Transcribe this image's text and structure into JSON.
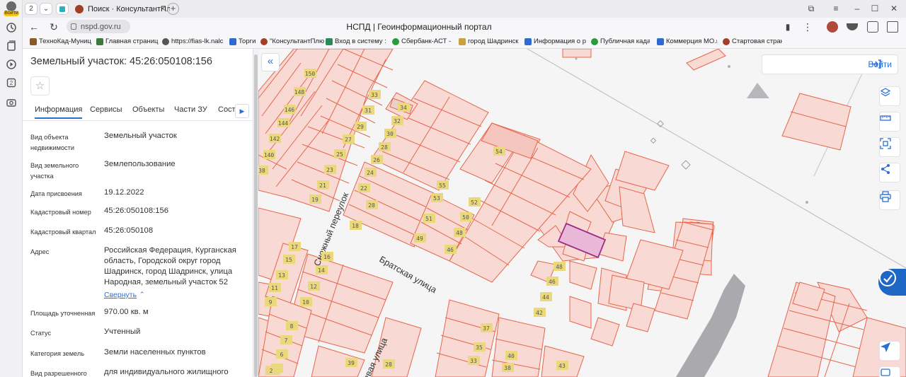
{
  "browser": {
    "tab_count": "2",
    "active_tab_title": "Поиск · КонсультантПлю",
    "url": "nspd.gov.ru",
    "page_title": "НСПД | Геоинформационный портал",
    "avatar_label": "Войти"
  },
  "bookmarks": [
    {
      "label": "ТехноКад-Муниц",
      "color": "#8a5a2b"
    },
    {
      "label": "Главная страниц",
      "color": "#3c7a3c"
    },
    {
      "label": "https://fias-lk.nalc",
      "color": "#555555"
    },
    {
      "label": "Торги",
      "color": "#2d6bd0"
    },
    {
      "label": "\"КонсультантПлю",
      "color": "#a04028"
    },
    {
      "label": "Вход в систему :",
      "color": "#2c8a5a"
    },
    {
      "label": "Сбербанк-АСТ -",
      "color": "#2a9a3a"
    },
    {
      "label": "город Шадринск",
      "color": "#c8a040"
    },
    {
      "label": "Информация о р",
      "color": "#2d6bd0"
    },
    {
      "label": "Публичная кадас",
      "color": "#2a9a3a"
    },
    {
      "label": "Коммерция МО.к",
      "color": "#2d6bd0"
    },
    {
      "label": "Стартовая стран",
      "color": "#a04028"
    }
  ],
  "panel": {
    "title": "Земельный участок: 45:26:050108:156",
    "tabs": [
      "Информация",
      "Сервисы",
      "Объекты",
      "Части ЗУ",
      "Соста"
    ],
    "rows": [
      {
        "key": "Вид объекта недвижимости",
        "value": "Земельный участок"
      },
      {
        "key": "Вид земельного участка",
        "value": "Землепользование"
      },
      {
        "key": "Дата присвоения",
        "value": "19.12.2022"
      },
      {
        "key": "Кадастровый номер",
        "value": "45:26:050108:156"
      },
      {
        "key": "Кадастровый квартал",
        "value": "45:26:050108"
      },
      {
        "key": "Адрес",
        "value": "Российская Федерация, Курганская область, Городской округ город Шадринск, город Шадринск, улица Народная, земельный участок 52"
      },
      {
        "key": "Площадь уточненная",
        "value": "970.00 кв. м"
      },
      {
        "key": "Статус",
        "value": "Учтенный"
      },
      {
        "key": "Категория земель",
        "value": "Земли населенных пунктов"
      },
      {
        "key": "Вид разрешенного",
        "value": "для индивидуального жилищного"
      }
    ],
    "collapse_label": "Свернуть"
  },
  "map": {
    "login_label": "Войти",
    "streets": [
      "Снежный переулок",
      "Братская улица",
      "евая улица"
    ],
    "lot_labels": [
      "150",
      "148",
      "146",
      "144",
      "142",
      "140",
      "38",
      "33",
      "34",
      "31",
      "32",
      "29",
      "30",
      "27",
      "28",
      "25",
      "26",
      "23",
      "24",
      "21",
      "22",
      "19",
      "20",
      "18",
      "17",
      "16",
      "15",
      "14",
      "13",
      "12",
      "11",
      "10",
      "9",
      "8",
      "7",
      "6",
      "5",
      "4",
      "2",
      "55",
      "53",
      "54",
      "52",
      "51",
      "50",
      "49",
      "48",
      "46",
      "48",
      "46",
      "44",
      "42",
      "37",
      "35",
      "33",
      "40",
      "38",
      "43",
      "39",
      "28"
    ],
    "colors": {
      "parcel_fill": "#f9d9d3",
      "parcel_stroke": "#e5664d",
      "selected_fill": "#e9b8d8",
      "selected_stroke": "#9b2c8a",
      "label_bg": "#ecd87c",
      "accent": "#2b6fd6"
    }
  }
}
